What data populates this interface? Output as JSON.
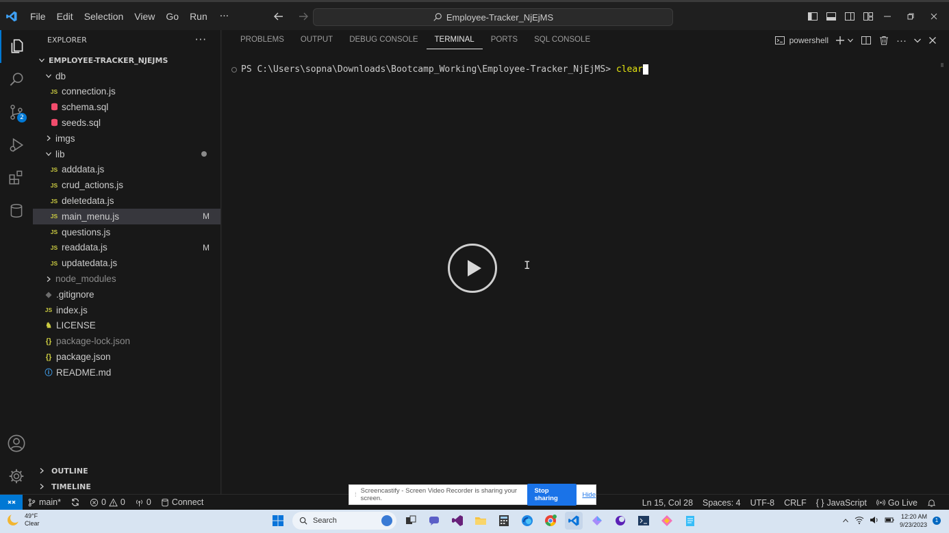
{
  "menu": [
    "File",
    "Edit",
    "Selection",
    "View",
    "Go",
    "Run"
  ],
  "menu_more": "···",
  "command_center": "Employee-Tracker_NjEjMS",
  "activity": {
    "scm_badge": "2"
  },
  "explorer": {
    "title": "EXPLORER",
    "more": "···",
    "root": "EMPLOYEE-TRACKER_NJEJMS",
    "items": [
      {
        "label": "db",
        "type": "folder-open",
        "indent": 1
      },
      {
        "label": "connection.js",
        "type": "js",
        "indent": 2
      },
      {
        "label": "schema.sql",
        "type": "sql",
        "indent": 2
      },
      {
        "label": "seeds.sql",
        "type": "sql",
        "indent": 2
      },
      {
        "label": "imgs",
        "type": "folder",
        "indent": 1
      },
      {
        "label": "lib",
        "type": "folder-open",
        "indent": 1,
        "dot": true
      },
      {
        "label": "adddata.js",
        "type": "js",
        "indent": 2
      },
      {
        "label": "crud_actions.js",
        "type": "js",
        "indent": 2
      },
      {
        "label": "deletedata.js",
        "type": "js",
        "indent": 2
      },
      {
        "label": "main_menu.js",
        "type": "js",
        "indent": 2,
        "status": "M",
        "selected": true
      },
      {
        "label": "questions.js",
        "type": "js",
        "indent": 2
      },
      {
        "label": "readdata.js",
        "type": "js",
        "indent": 2,
        "status": "M"
      },
      {
        "label": "updatedata.js",
        "type": "js",
        "indent": 2
      },
      {
        "label": "node_modules",
        "type": "folder",
        "indent": 1,
        "dim": true
      },
      {
        "label": ".gitignore",
        "type": "git",
        "indent": 1
      },
      {
        "label": "index.js",
        "type": "js",
        "indent": 1
      },
      {
        "label": "LICENSE",
        "type": "lic",
        "indent": 1
      },
      {
        "label": "package-lock.json",
        "type": "json",
        "indent": 1,
        "dim": true
      },
      {
        "label": "package.json",
        "type": "json",
        "indent": 1
      },
      {
        "label": "README.md",
        "type": "md",
        "indent": 1
      }
    ],
    "outline": "OUTLINE",
    "timeline": "TIMELINE"
  },
  "panel": {
    "tabs": [
      "PROBLEMS",
      "OUTPUT",
      "DEBUG CONSOLE",
      "TERMINAL",
      "PORTS",
      "SQL CONSOLE"
    ],
    "active_tab": "TERMINAL",
    "shell": "powershell"
  },
  "terminal": {
    "prompt": "PS C:\\Users\\sopna\\Downloads\\Bootcamp_Working\\Employee-Tracker_NjEjMS> ",
    "command": "clear"
  },
  "statusbar": {
    "branch": "main*",
    "errors": "0",
    "warnings": "0",
    "ports": "0",
    "connect": "Connect",
    "position": "Ln 15, Col 28",
    "spaces": "Spaces: 4",
    "encoding": "UTF-8",
    "eol": "CRLF",
    "language": "JavaScript",
    "golive": "Go Live"
  },
  "share_banner": {
    "text": "Screencastify - Screen Video Recorder is sharing your screen.",
    "stop": "Stop sharing",
    "hide": "Hide"
  },
  "taskbar": {
    "temp": "49°F",
    "weather": "Clear",
    "search": "Search",
    "time": "12:20 AM",
    "date": "9/23/2023",
    "notif_count": "1"
  },
  "colors": {
    "accent": "#0078d4",
    "background": "#1f1f1f",
    "sidebar": "#181818",
    "command": "#e5e510"
  }
}
